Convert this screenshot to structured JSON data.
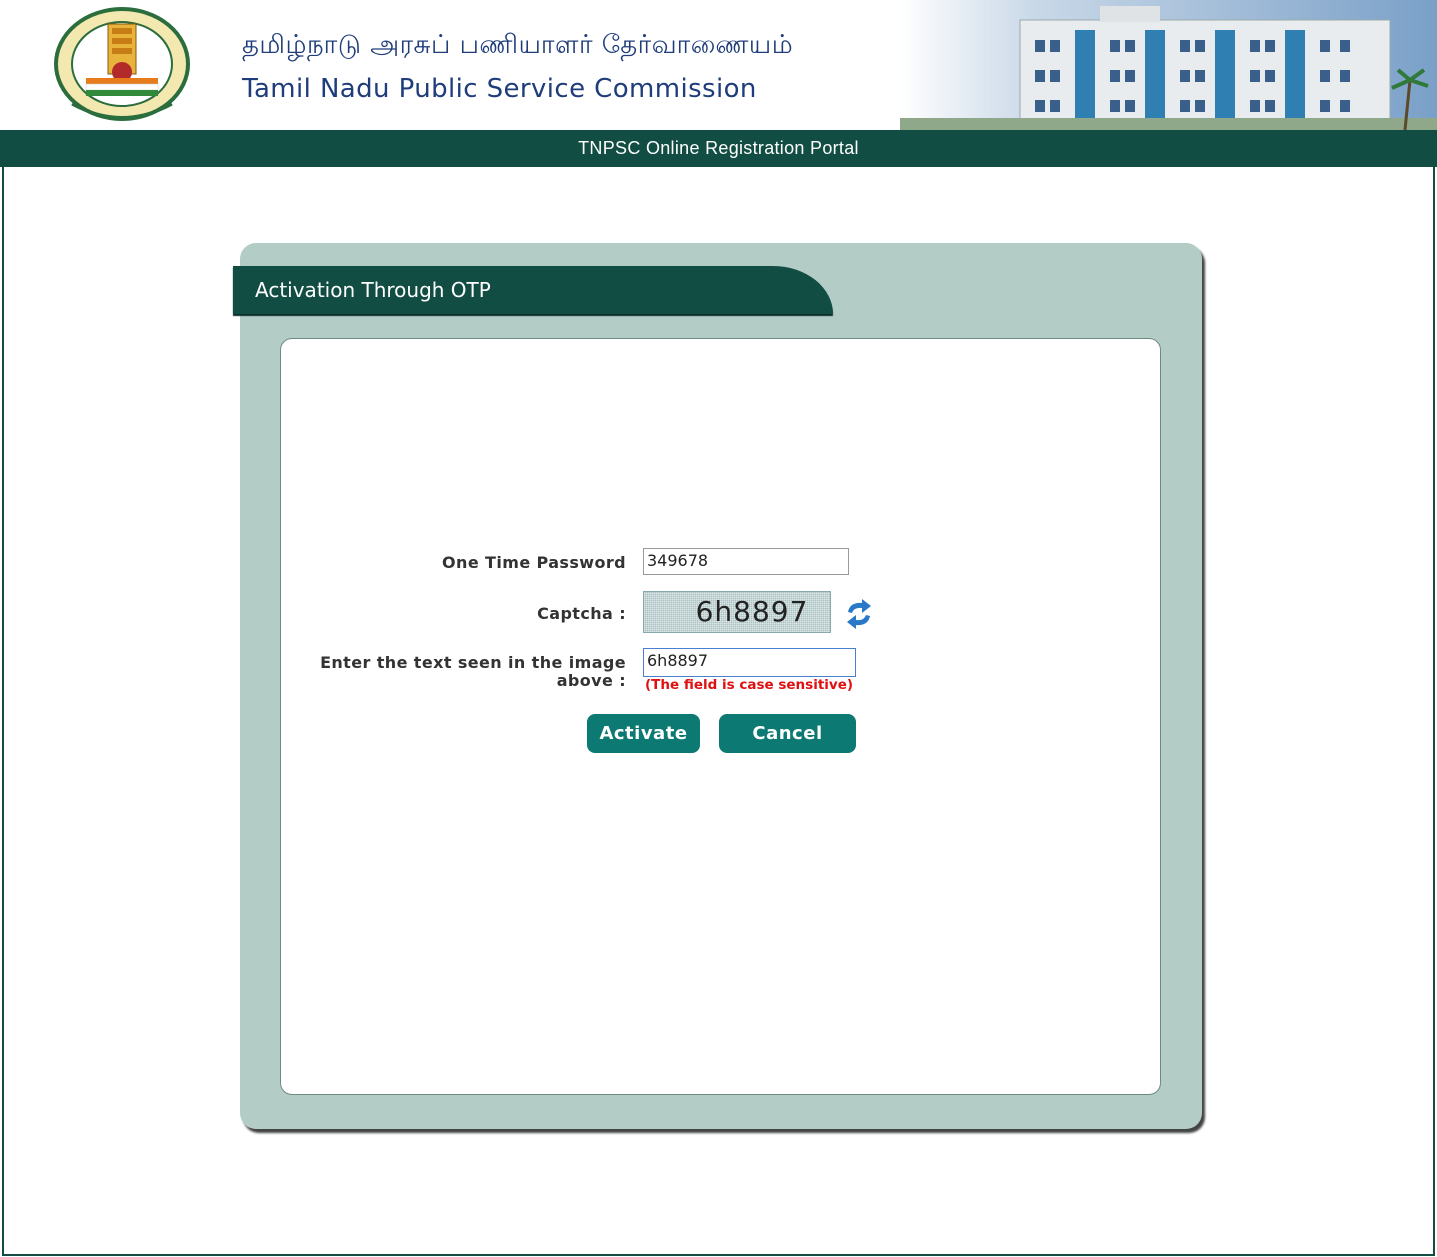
{
  "header": {
    "title_tamil": "தமிழ்நாடு அரசுப் பணியாளர் தேர்வாணையம்",
    "title_english": "Tamil Nadu Public Service Commission",
    "emblem_icon": "tamil-nadu-emblem-icon",
    "building_image": "commission-building-image"
  },
  "portal_bar": {
    "title": "TNPSC Online Registration Portal",
    "color": "#124d44"
  },
  "panel": {
    "title": "Activation Through OTP",
    "background": "#b3ccc6"
  },
  "form": {
    "otp_label": "One Time Password",
    "otp_value": "349678",
    "captcha_label": "Captcha :",
    "captcha_text": "6h8897",
    "refresh_icon": "refresh-icon",
    "captcha_input_label_line1": "Enter the text seen in the image",
    "captcha_input_label_line2": "above :",
    "captcha_input_value": "6h8897",
    "case_hint": "(The field is case sensitive)"
  },
  "buttons": {
    "activate": "Activate",
    "cancel": "Cancel",
    "color": "#0c7a72"
  }
}
